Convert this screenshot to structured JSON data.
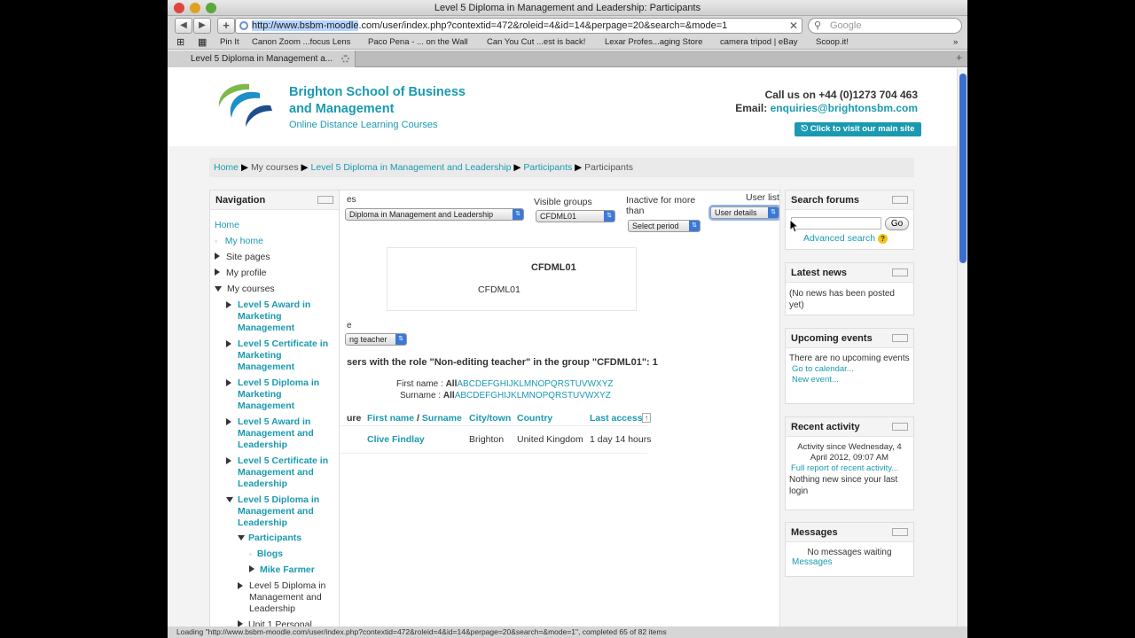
{
  "window": {
    "title": "Level 5 Diploma in Management and Leadership: Participants"
  },
  "browser": {
    "url_selected": "http://www.bsbm-moodle",
    "url_rest": ".com/user/index.php?contextid=472&roleid=4&id=14&perpage=20&search=&mode=1",
    "search_placeholder": "Google",
    "bookmarks": [
      "Pin It",
      "Canon Zoom ...focus Lens",
      "Paco Pena - ... on the Wall",
      "Can You Cut ...est is back!",
      "Lexar Profes...aging Store",
      "camera tripod | eBay",
      "Scoop.it!"
    ],
    "tab_title": "Level 5 Diploma in Management a...",
    "status": "Loading \"http://www.bsbm-moodle.com/user/index.php?contextid=472&roleid=4&id=14&perpage=20&search=&mode=1\", completed 65 of 82 items"
  },
  "header": {
    "school_line1": "Brighton School of Business",
    "school_line2": "and Management",
    "tagline": "Online Distance Learning Courses",
    "call": "Call us on +44 (0)1273 704 463",
    "email_label": "Email:",
    "email": "enquiries@brightonsbm.com",
    "visit_btn": "Click to visit our main site"
  },
  "breadcrumb": [
    "Home",
    "My courses",
    "Level 5 Diploma in Management and Leadership",
    "Participants",
    "Participants"
  ],
  "navigation": {
    "title": "Navigation",
    "home": "Home",
    "my_home": "My home",
    "site_pages": "Site pages",
    "my_profile": "My profile",
    "my_courses": "My courses",
    "courses": [
      [
        "Level 5 Award in",
        "Marketing",
        "Management"
      ],
      [
        "Level 5 Certificate in",
        "Marketing",
        "Management"
      ],
      [
        "Level 5 Diploma in",
        "Marketing",
        "Management"
      ],
      [
        "Level 5 Award in",
        "Management and",
        "Leadership"
      ],
      [
        "Level 5 Certificate in",
        "Management and",
        "Leadership"
      ],
      [
        "Level 5 Diploma in",
        "Management and",
        "Leadership"
      ]
    ],
    "participants": "Participants",
    "blogs": "Blogs",
    "mike": "Mike Farmer",
    "dip2": [
      "Level 5 Diploma in",
      "Management and",
      "Leadership"
    ],
    "unit1": "Unit 1 Personal"
  },
  "filters": {
    "courses_label": "es",
    "course_value": "Diploma in Management and Leadership",
    "visible_groups_label": "Visible groups",
    "group_value": "CFDML01",
    "inactive_label1": "Inactive for more",
    "inactive_label2": "than",
    "period_value": "Select period",
    "userlist_label": "User list",
    "userlist_value": "User details",
    "role_label": "e",
    "role_value": "ng teacher"
  },
  "group_box": {
    "title": "CFDML01",
    "desc": "CFDML01"
  },
  "users": {
    "heading": "sers with the role \"Non-editing teacher\" in the group \"CFDML01\": 1",
    "firstname_label": "First name :",
    "surname_label": "Surname :",
    "all": "All",
    "letters": "ABCDEFGHIJKLMNOPQRSTUVWXYZ",
    "columns": {
      "picture": "ure",
      "firstname": "First name",
      "sep": " / ",
      "surname": "Surname",
      "city": "City/town",
      "country": "Country",
      "lastaccess": "Last access"
    },
    "rows": [
      {
        "name": "Clive Findlay",
        "city": "Brighton",
        "country": "United Kingdom",
        "last": "1 day 14 hours"
      }
    ]
  },
  "blocks": {
    "search": {
      "title": "Search forums",
      "go": "Go",
      "advanced": "Advanced search"
    },
    "news": {
      "title": "Latest news",
      "text": "(No news has been posted yet)"
    },
    "events": {
      "title": "Upcoming events",
      "text": "There are no upcoming events",
      "calendar": "Go to calendar...",
      "new_event": "New event..."
    },
    "activity": {
      "title": "Recent activity",
      "since": "Activity since Wednesday, 4 April 2012, 09:07 AM",
      "full": "Full report of recent activity...",
      "nothing": "Nothing new since your last login"
    },
    "messages": {
      "title": "Messages",
      "text": "No messages waiting",
      "link": "Messages"
    }
  }
}
